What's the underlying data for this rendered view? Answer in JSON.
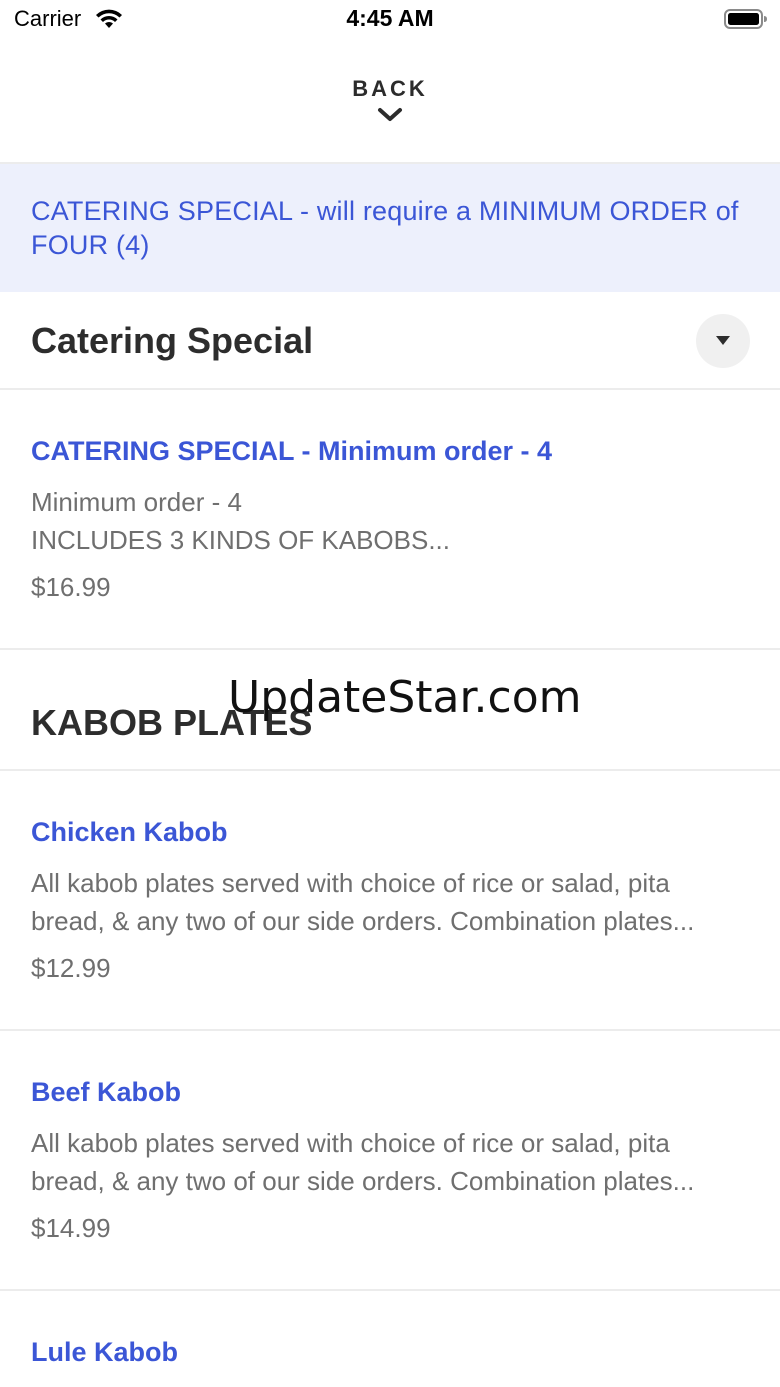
{
  "status_bar": {
    "carrier": "Carrier",
    "time": "4:45 AM"
  },
  "header": {
    "back_label": "BACK"
  },
  "banner": {
    "text": "CATERING SPECIAL - will require a MINIMUM ORDER of FOUR (4)"
  },
  "sections": [
    {
      "title": "Catering Special",
      "items": [
        {
          "name": "CATERING SPECIAL - Minimum order - 4",
          "description": "Minimum order - 4\nINCLUDES 3 KINDS OF KABOBS...",
          "price": "$16.99"
        }
      ]
    },
    {
      "title": "KABOB PLATES",
      "items": [
        {
          "name": "Chicken Kabob",
          "description": "All kabob plates served with choice of rice or salad, pita bread, & any two of our side orders. Combination plates...",
          "price": "$12.99"
        },
        {
          "name": "Beef Kabob",
          "description": "All kabob plates served with choice of rice or salad, pita bread, & any two of our side orders. Combination plates...",
          "price": "$14.99"
        },
        {
          "name": "Lule Kabob"
        }
      ]
    }
  ],
  "watermark": "UpdateStar.com",
  "colors": {
    "accent": "#3b56d6",
    "banner_bg": "#edf0fc",
    "muted_text": "#6f6f6f"
  }
}
